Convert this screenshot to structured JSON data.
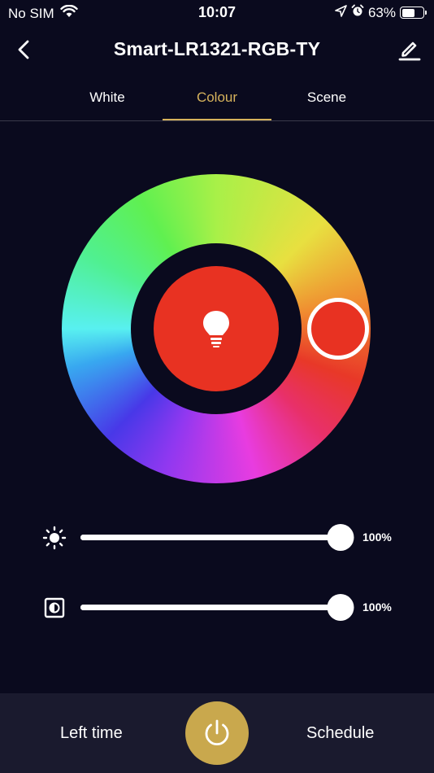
{
  "status_bar": {
    "carrier": "No SIM",
    "time": "10:07",
    "battery": "63%",
    "battery_level": 0.63
  },
  "header": {
    "title": "Smart-LR1321-RGB-TY",
    "back_icon": "chevron-left-icon",
    "edit_icon": "pencil-icon"
  },
  "tabs": [
    {
      "label": "White",
      "active": false
    },
    {
      "label": "Colour",
      "active": true
    },
    {
      "label": "Scene",
      "active": false
    }
  ],
  "colors": {
    "accent": "#d6b25c",
    "selected_color": "#e83222",
    "background": "#0a0a1e",
    "bottom_bar": "#1a1a2e",
    "power_button": "#c9a84d"
  },
  "color_wheel": {
    "center_icon": "light-bulb-icon"
  },
  "sliders": {
    "brightness": {
      "icon": "sun-icon",
      "label": "100%",
      "level": 1.0
    },
    "saturation": {
      "icon": "contrast-icon",
      "label": "100%",
      "level": 1.0
    }
  },
  "bottom_bar": {
    "left_time": "Left time",
    "schedule": "Schedule",
    "power_icon": "power-icon"
  }
}
